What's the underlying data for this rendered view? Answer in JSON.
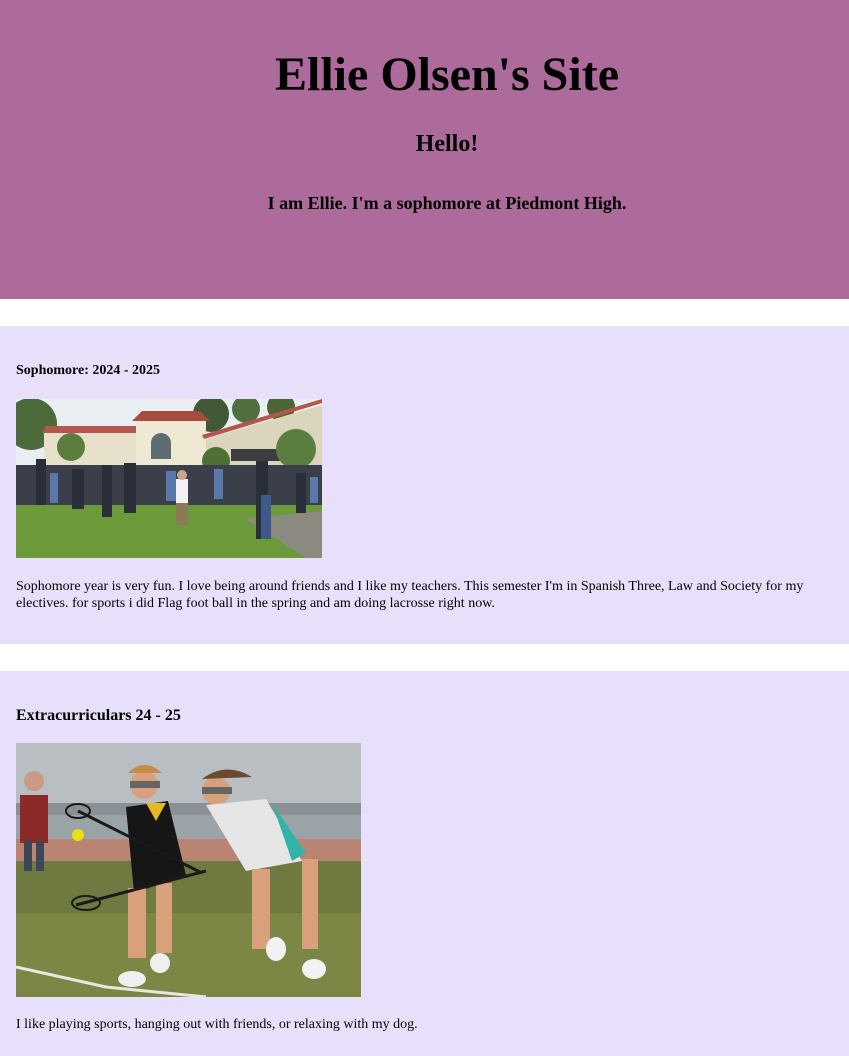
{
  "header": {
    "title": "Ellie Olsen's Site",
    "greeting": "Hello!",
    "intro": "I am Ellie. I'm a sophomore at Piedmont High."
  },
  "sections": [
    {
      "heading": "Sophomore: 2024 - 2025",
      "image_alt": "Students gathered on the lawn in front of the high school",
      "text": "Sophomore year is very fun. I love being around friends and I like my teachers. This semester I'm in Spanish Three, Law and Society for my electives. for sports i did Flag foot ball in the spring and am doing lacrosse right now."
    },
    {
      "heading": "Extracurriculars 24 - 25",
      "image_alt": "Two girls playing lacrosse on a field",
      "text": "I like playing sports, hanging out with friends, or relaxing with my dog."
    }
  ],
  "colors": {
    "header_bg": "#ac6b9b",
    "section_bg": "#e8e0fa",
    "page_bg": "#ffffff"
  }
}
